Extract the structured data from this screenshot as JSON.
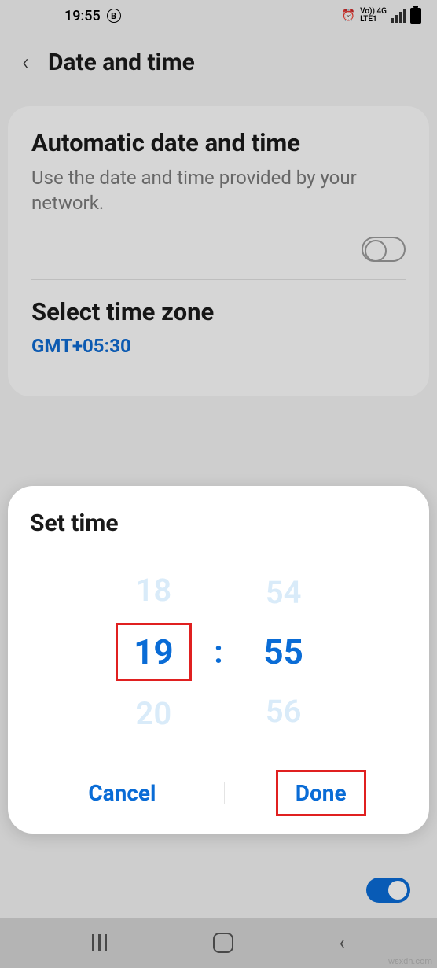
{
  "status": {
    "time": "19:55",
    "badge": "B",
    "network_label": "Vo)) 4G",
    "lte_label": "LTE1"
  },
  "header": {
    "title": "Date and time"
  },
  "settings": {
    "auto": {
      "title": "Automatic date and time",
      "description": "Use the date and time provided by your network."
    },
    "timezone": {
      "title": "Select time zone",
      "value": "GMT+05:30"
    }
  },
  "dialog": {
    "title": "Set time",
    "hour_prev": "18",
    "hour_current": "19",
    "hour_next": "20",
    "minute_prev": "54",
    "minute_current": "55",
    "minute_next": "56",
    "separator": ":",
    "cancel_label": "Cancel",
    "done_label": "Done"
  },
  "watermark": "wsxdn.com"
}
